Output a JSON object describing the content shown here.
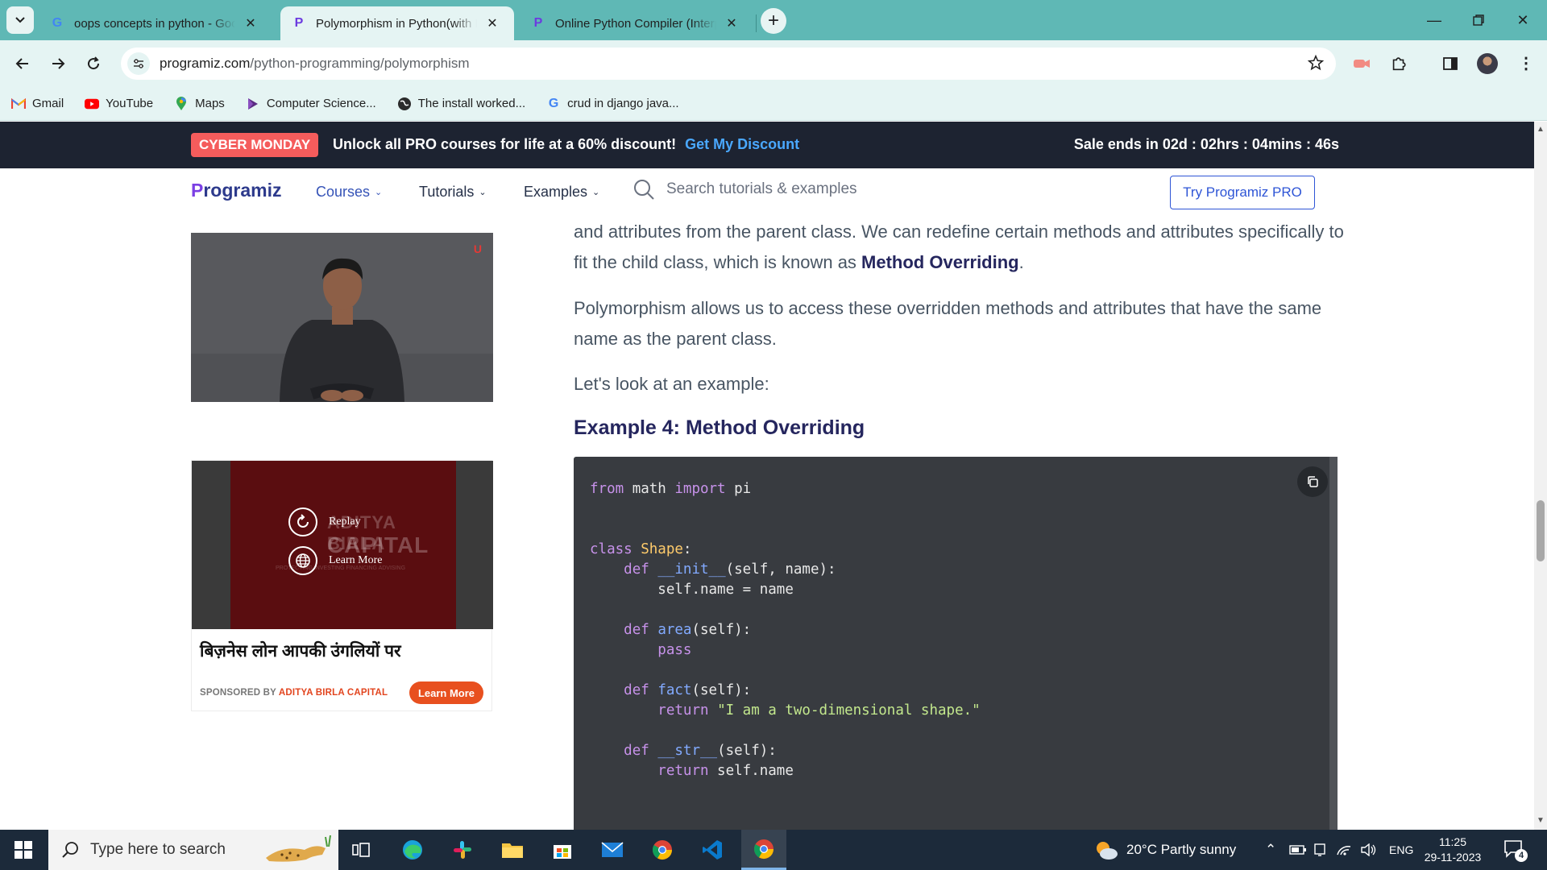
{
  "browser": {
    "tabs": [
      {
        "title": "oops concepts in python - Google Search",
        "favicon": "google-icon",
        "active": false
      },
      {
        "title": "Polymorphism in Python(with Examples)",
        "favicon": "programiz-icon",
        "active": true
      },
      {
        "title": "Online Python Compiler (Interpreter)",
        "favicon": "programiz-icon",
        "active": false
      }
    ],
    "url_domain": "programiz.com",
    "url_path": "/python-programming/polymorphism",
    "bookmarks": [
      {
        "label": "Gmail",
        "icon": "gmail-icon"
      },
      {
        "label": "YouTube",
        "icon": "youtube-icon"
      },
      {
        "label": "Maps",
        "icon": "maps-icon"
      },
      {
        "label": "Computer Science...",
        "icon": "bookmark-icon"
      },
      {
        "label": "The install worked...",
        "icon": "globe-icon"
      },
      {
        "label": "crud in django java...",
        "icon": "google-icon"
      }
    ]
  },
  "promo": {
    "badge": "CYBER MONDAY",
    "text": "Unlock all PRO courses for life at a 60% discount!",
    "link": "Get My Discount",
    "timer": "Sale ends in 02d : 02hrs : 04mins : 46s"
  },
  "nav": {
    "logo_p": "P",
    "logo_rest": "rogramiz",
    "items": [
      "Courses",
      "Tutorials",
      "Examples"
    ],
    "search_placeholder": "Search tutorials & examples",
    "pro_button": "Try Programiz PRO"
  },
  "article": {
    "p1_a": "and attributes from the parent class. We can redefine certain methods and attributes specifically to fit the child class, which is known as ",
    "p1_strong": "Method Overriding",
    "p1_end": ".",
    "p2": "Polymorphism allows us to access these overridden methods and attributes that have the same name as the parent class.",
    "p3": "Let's look at an example:",
    "example_title": "Example 4: Method Overriding",
    "code": {
      "l1_kw1": "from",
      "l1_mod": " math ",
      "l1_kw2": "import",
      "l1_name": " pi",
      "l2_kw": "class",
      "l2_name": "Shape",
      "l3_kw": "def",
      "l3_fn": "__init__",
      "l3_args": "(self, name):",
      "l4": "self.name = name",
      "l5_kw": "def",
      "l5_fn": "area",
      "l5_args": "(self):",
      "l6_kw": "pass",
      "l7_kw": "def",
      "l7_fn": "fact",
      "l7_args": "(self):",
      "l8_kw": "return",
      "l8_str": "\"I am a two-dimensional shape.\"",
      "l9_kw": "def",
      "l9_fn": "__str__",
      "l9_args": "(self):",
      "l10_kw": "return",
      "l10_rest": " self.name"
    }
  },
  "ads": {
    "video_brand": "U",
    "card_watermark_1": "ADITYA BIRLA",
    "card_watermark_2": "CAPITAL",
    "card_watermark_3": "PROTECTING   INVESTING   FINANCING   ADVISING",
    "replay": "Replay",
    "learn_more_overlay": "Learn More",
    "headline": "बिज़नेस लोन आपकी उंगलियों पर",
    "sponsored_by": "SPONSORED BY",
    "sponsor_name": "ADITYA BIRLA CAPITAL",
    "learn_more_button": "Learn More"
  },
  "taskbar": {
    "search_placeholder": "Type here to search",
    "weather": "20°C  Partly sunny",
    "language": "ENG",
    "time": "11:25",
    "date": "29-11-2023",
    "notification_count": "4"
  },
  "colors": {
    "tabstrip": "#5fb8b5",
    "promo_bg": "#1d2331",
    "badge": "#f55c5c",
    "link_blue": "#4aa8ff",
    "heading": "#25265e",
    "code_bg": "#383b40"
  }
}
